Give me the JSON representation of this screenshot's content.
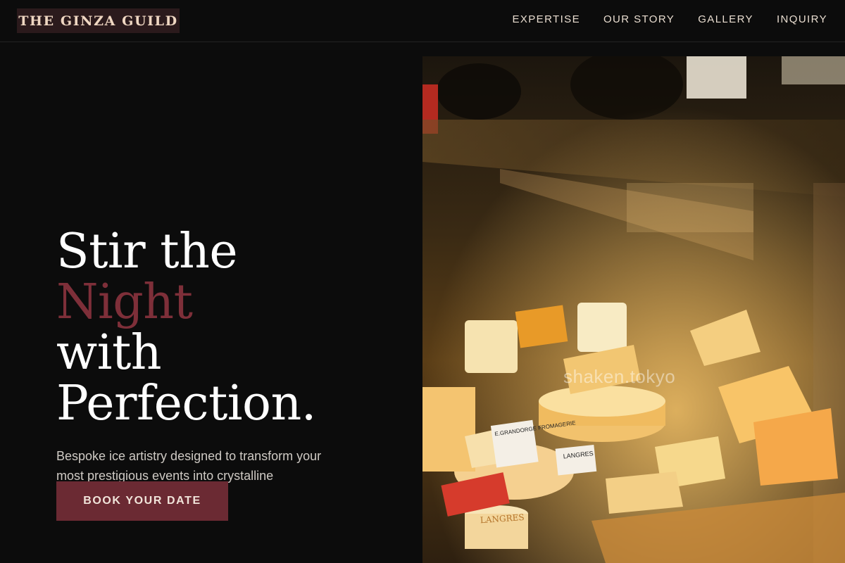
{
  "brand": {
    "logo_text": "THE GINZA GUILD"
  },
  "nav": {
    "items": [
      {
        "label": "EXPERTISE"
      },
      {
        "label": "OUR STORY"
      },
      {
        "label": "GALLERY"
      },
      {
        "label": "INQUIRY"
      }
    ]
  },
  "hero": {
    "headline_part1": "Stir the ",
    "headline_accent": "Night",
    "headline_line2": "with",
    "headline_line3": "Perfection.",
    "subtitle": "Bespoke ice artistry designed to transform your most prestigious events into crystalline masterpieces.",
    "cta_label": "BOOK YOUR DATE",
    "accent_color": "#7e2f39"
  },
  "photo": {
    "watermark": "shaken.tokyo",
    "labels": {
      "l1": "E.GRANDORGE FROMAGERIE",
      "l2": "LANGRES",
      "l3": "LANGRES"
    }
  }
}
